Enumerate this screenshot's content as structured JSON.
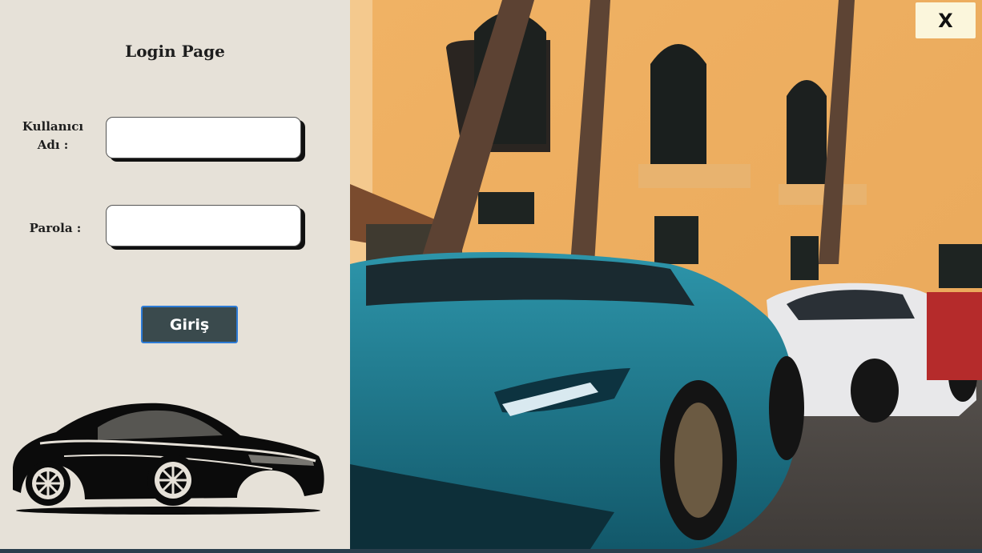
{
  "login": {
    "title": "Login Page",
    "username_label": "Kullanıcı\nAdı :",
    "password_label": "Parola :",
    "username_value": "",
    "password_value": "",
    "submit_label": "Giriş"
  },
  "window": {
    "close_label": "X"
  },
  "colors": {
    "panel_bg": "#e6e1d8",
    "button_bg": "#3a4a4d",
    "button_border": "#2d7bd6",
    "close_bg": "#fbf6dc"
  },
  "icons": {
    "car_silhouette": "car-silhouette-icon",
    "background_photo": "sports-cars-photo"
  }
}
